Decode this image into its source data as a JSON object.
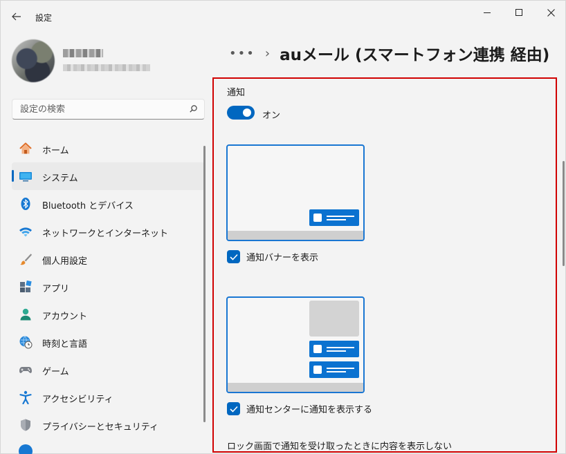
{
  "window": {
    "app_title": "設定",
    "back_icon": "back-arrow-icon",
    "controls": [
      "minimize",
      "maximize",
      "close"
    ]
  },
  "search": {
    "placeholder": "設定の検索",
    "icon": "search-icon"
  },
  "sidebar": {
    "items": [
      {
        "label": "ホーム",
        "icon": "home-icon",
        "active": false
      },
      {
        "label": "システム",
        "icon": "system-icon",
        "active": true
      },
      {
        "label": "Bluetooth とデバイス",
        "icon": "bluetooth-icon",
        "active": false
      },
      {
        "label": "ネットワークとインターネット",
        "icon": "wifi-icon",
        "active": false
      },
      {
        "label": "個人用設定",
        "icon": "brush-icon",
        "active": false
      },
      {
        "label": "アプリ",
        "icon": "apps-icon",
        "active": false
      },
      {
        "label": "アカウント",
        "icon": "account-icon",
        "active": false
      },
      {
        "label": "時刻と言語",
        "icon": "time-language-icon",
        "active": false
      },
      {
        "label": "ゲーム",
        "icon": "gaming-icon",
        "active": false
      },
      {
        "label": "アクセシビリティ",
        "icon": "accessibility-icon",
        "active": false
      },
      {
        "label": "プライバシーとセキュリティ",
        "icon": "shield-icon",
        "active": false
      }
    ]
  },
  "breadcrumb": {
    "more": "•••",
    "separator": "›",
    "title": "auメール (スマートフォン連携 経由)"
  },
  "notifications": {
    "section_label": "通知",
    "toggle_state": "オン",
    "toggle_on": true,
    "show_banner_label": "通知バナーを表示",
    "show_banner_checked": true,
    "show_in_center_label": "通知センターに通知を表示する",
    "show_in_center_checked": true,
    "lock_screen_label": "ロック画面で通知を受け取ったときに内容を表示しない"
  },
  "colors": {
    "accent": "#0067c0",
    "preview_border": "#1976d2",
    "highlight_border": "#d00000",
    "background": "#f3f3f3"
  }
}
